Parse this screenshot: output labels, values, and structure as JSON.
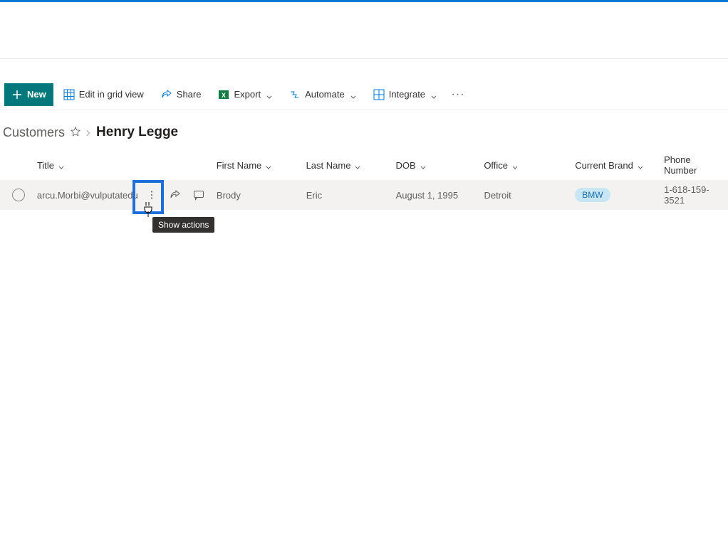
{
  "commandBar": {
    "new": "New",
    "editGrid": "Edit in grid view",
    "share": "Share",
    "export": "Export",
    "automate": "Automate",
    "integrate": "Integrate"
  },
  "breadcrumb": {
    "root": "Customers",
    "current": "Henry Legge"
  },
  "columns": {
    "title": "Title",
    "first": "First Name",
    "last": "Last Name",
    "dob": "DOB",
    "office": "Office",
    "brand": "Current Brand",
    "phone": "Phone Number"
  },
  "row": {
    "title": "arcu.Morbi@vulputatedui...",
    "first": "Brody",
    "last": "Eric",
    "dob": "August 1, 1995",
    "office": "Detroit",
    "brand": "BMW",
    "phone": "1-618-159-3521"
  },
  "tooltip": "Show actions",
  "icons": {
    "plus": "plus-icon",
    "grid": "grid-icon",
    "share": "share-icon",
    "excel": "excel-icon",
    "automate": "automate-icon",
    "integrate": "integrate-icon",
    "chevronDown": "chevron-down-icon",
    "ellipsis": "ellipsis-icon",
    "star": "star-icon",
    "chevronRight": "chevron-right-icon",
    "radio": "radio-icon",
    "vdots": "vertical-dots-icon",
    "shareRow": "share-row-icon",
    "comment": "comment-icon",
    "cursor": "cursor-icon"
  }
}
